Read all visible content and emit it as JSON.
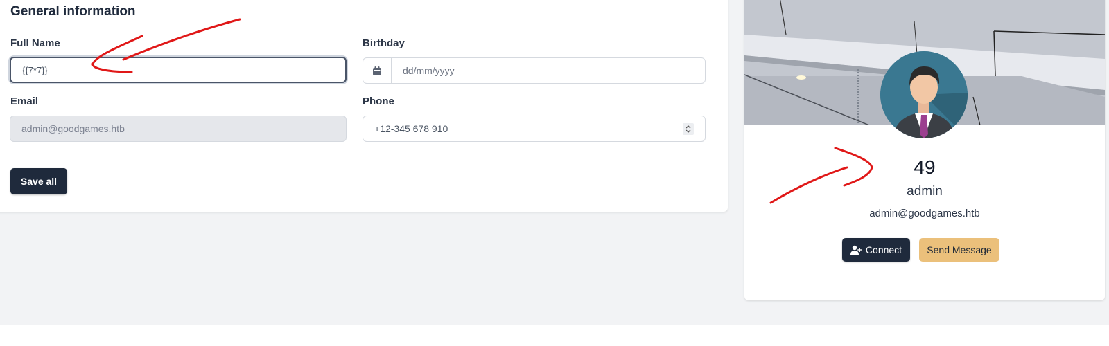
{
  "general": {
    "title": "General information",
    "full_name_label": "Full Name",
    "full_name_value": "{{7*7}}",
    "birthday_label": "Birthday",
    "birthday_placeholder": "dd/mm/yyyy",
    "email_label": "Email",
    "email_value": "admin@goodgames.htb",
    "phone_label": "Phone",
    "phone_value": "+12-345 678 910",
    "save_label": "Save all"
  },
  "profile": {
    "number": "49",
    "name": "admin",
    "email": "admin@goodgames.htb",
    "connect_label": "Connect",
    "message_label": "Send Message"
  },
  "icons": [
    "calendar-icon",
    "spinner-icon",
    "user-plus-icon",
    "avatar-icon"
  ],
  "colors": {
    "dark_button": "#1f2a3c",
    "message_button": "#ebc07b",
    "annotation": "#e01818"
  }
}
